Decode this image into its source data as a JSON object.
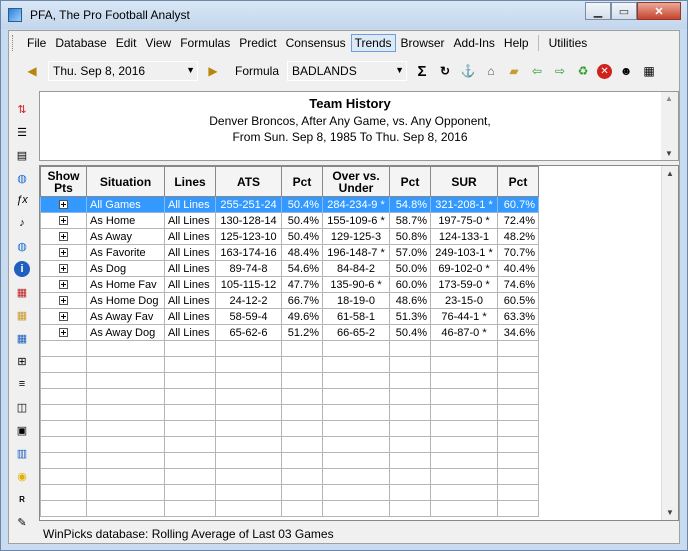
{
  "window": {
    "title": "PFA,  The Pro Football Analyst"
  },
  "menu": [
    "File",
    "Database",
    "Edit",
    "View",
    "Formulas",
    "Predict",
    "Consensus",
    "Trends",
    "Browser",
    "Add-Ins",
    "Help",
    "Utilities"
  ],
  "menu_active": "Trends",
  "toolbar": {
    "date_value": "Thu. Sep  8, 2016",
    "formula_label": "Formula",
    "formula_value": "BADLANDS"
  },
  "header": {
    "title": "Team History",
    "line1": "Denver Broncos, After Any Game, vs. Any Opponent,",
    "line2": "From Sun. Sep 8, 1985 To Thu. Sep 8, 2016"
  },
  "grid": {
    "columns": [
      "Show Pts",
      "Situation",
      "Lines",
      "ATS",
      "Pct",
      "Over vs. Under",
      "Pct",
      "SUR",
      "Pct"
    ],
    "rows": [
      [
        "All Games",
        "All Lines",
        "255-251-24",
        "50.4%",
        "284-234-9 *",
        "54.8%",
        "321-208-1 *",
        "60.7%"
      ],
      [
        "As Home",
        "All Lines",
        "130-128-14",
        "50.4%",
        "155-109-6 *",
        "58.7%",
        "197-75-0 *",
        "72.4%"
      ],
      [
        "As Away",
        "All Lines",
        "125-123-10",
        "50.4%",
        "129-125-3",
        "50.8%",
        "124-133-1",
        "48.2%"
      ],
      [
        "As Favorite",
        "All Lines",
        "163-174-16",
        "48.4%",
        "196-148-7 *",
        "57.0%",
        "249-103-1 *",
        "70.7%"
      ],
      [
        "As Dog",
        "All Lines",
        "89-74-8",
        "54.6%",
        "84-84-2",
        "50.0%",
        "69-102-0 *",
        "40.4%"
      ],
      [
        "As Home Fav",
        "All Lines",
        "105-115-12",
        "47.7%",
        "135-90-6 *",
        "60.0%",
        "173-59-0 *",
        "74.6%"
      ],
      [
        "As Home Dog",
        "All Lines",
        "24-12-2",
        "66.7%",
        "18-19-0",
        "48.6%",
        "23-15-0",
        "60.5%"
      ],
      [
        "As Away Fav",
        "All Lines",
        "58-59-4",
        "49.6%",
        "61-58-1",
        "51.3%",
        "76-44-1 *",
        "63.3%"
      ],
      [
        "As Away Dog",
        "All Lines",
        "65-62-6",
        "51.2%",
        "66-65-2",
        "50.4%",
        "46-87-0 *",
        "34.6%"
      ]
    ],
    "selected_row": 0,
    "empty_rows": 11
  },
  "status": {
    "text": "WinPicks database:  Rolling Average of Last 03 Games"
  },
  "colors": {
    "selection": "#3399ff",
    "title_bar": "#c9dbef"
  },
  "icons": {
    "toolbar": [
      "calendar-back-icon",
      "calendar-forward-icon",
      "sigma-icon",
      "refresh-icon",
      "anchor-icon",
      "home-icon",
      "open-folder-icon",
      "back-arrow-icon",
      "forward-arrow-icon",
      "recycle-icon",
      "stop-icon",
      "person-icon",
      "grid-icon"
    ],
    "sidebar": [
      "sort-icon",
      "list-icon",
      "document-icon",
      "globe-icon",
      "function-icon",
      "music-icon",
      "globe-network-icon",
      "info-icon",
      "spreadsheet-icon",
      "table-icon",
      "chart-table-icon",
      "add-row-icon",
      "tree-icon",
      "panel-icon",
      "window-icon",
      "bar-chart-icon",
      "lightbulb-icon",
      "code-icon",
      "edit-icon"
    ]
  }
}
